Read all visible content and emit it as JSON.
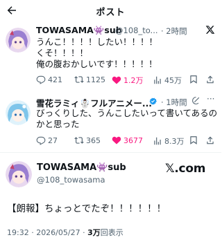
{
  "header": {
    "title": "ポスト"
  },
  "reply1": {
    "name": "TOWASAMA👾sub",
    "handle": "@108_to...",
    "time": "· 2時間",
    "text": "うんこ！！！！したい！！！！\nくそ！！！！\n俺の腹おかしいです！！！！！",
    "actions": {
      "replies": "421",
      "reposts": "1125",
      "likes": "1.2万",
      "views": "45万"
    }
  },
  "reply2": {
    "name": "雪花ラミィ☃️フルアニメー...",
    "time": "· 1時間",
    "text": "びっくりした、うんこしたいって書いてあるのかと思った",
    "actions": {
      "replies": "27",
      "reposts": "365",
      "likes": "3677",
      "views": "8.3万"
    }
  },
  "main": {
    "name": "TOWASAMA👾sub",
    "handle": "@108_towasama",
    "brand": "𝕏.com",
    "text": "【朗報】ちょっとでたぞ！！！！！！",
    "timestamp": "19:32 · 2026/05/27 · ",
    "views_count": "3万",
    "views_label": "回表示"
  },
  "colors": {
    "like": "#f91880",
    "muted": "#536471",
    "verified": "#1d9bf0"
  }
}
